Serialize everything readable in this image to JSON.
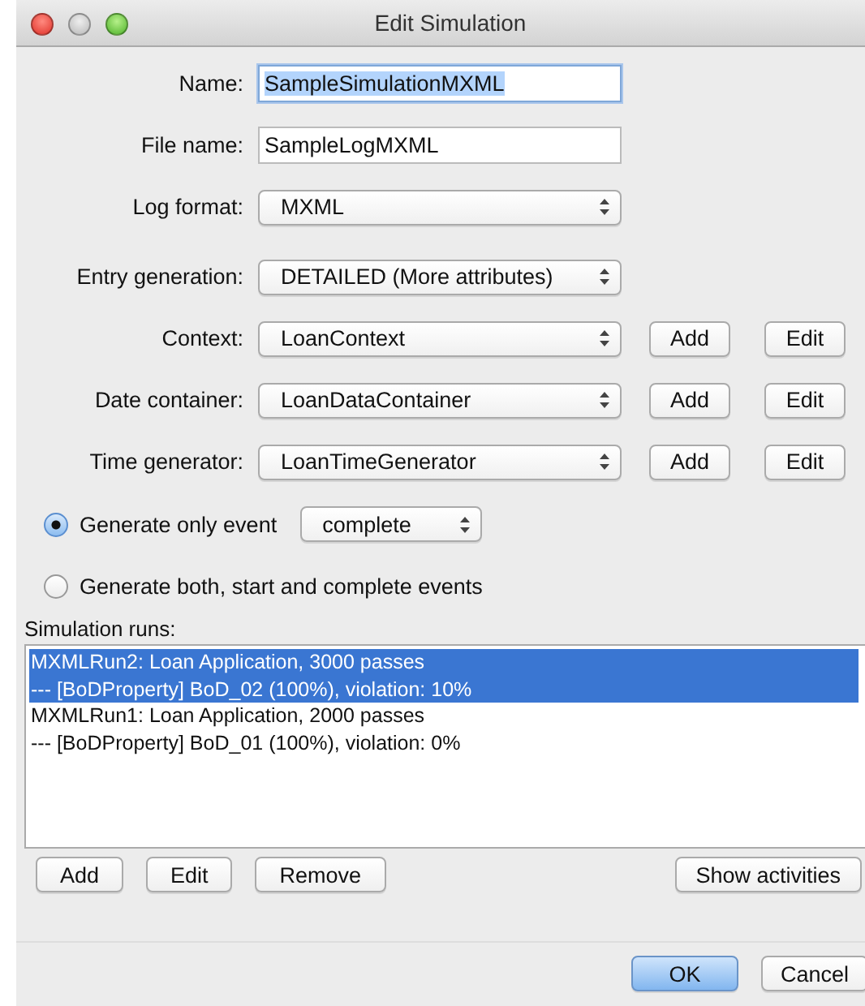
{
  "window": {
    "title": "Edit Simulation"
  },
  "form": [
    {
      "label": "Name:",
      "kind": "text",
      "value": "SampleSimulationMXML",
      "focused": true,
      "text_selected": true
    },
    {
      "label": "File name:",
      "kind": "text",
      "value": "SampleLogMXML",
      "focused": false,
      "text_selected": false
    },
    {
      "label": "Log format:",
      "kind": "select",
      "value": "MXML"
    },
    {
      "label": "Entry generation:",
      "kind": "select",
      "value": "DETAILED (More attributes)"
    },
    {
      "label": "Context:",
      "kind": "select",
      "value": "LoanContext",
      "buttons": [
        "Add",
        "Edit"
      ]
    },
    {
      "label": "Date container:",
      "kind": "select",
      "value": "LoanDataContainer",
      "buttons": [
        "Add",
        "Edit"
      ]
    },
    {
      "label": "Time generator:",
      "kind": "select",
      "value": "LoanTimeGenerator",
      "buttons": [
        "Add",
        "Edit"
      ]
    }
  ],
  "event_options": [
    {
      "label": "Generate only event",
      "selected": true,
      "select_value": "complete"
    },
    {
      "label": "Generate both, start and complete events",
      "selected": false
    }
  ],
  "simulation_runs": {
    "label": "Simulation runs:",
    "items": [
      {
        "line_1": "MXMLRun2: Loan Application, 3000 passes",
        "line_2": "--- [BoDProperty] BoD_02 (100%), violation: 10%",
        "selected": true
      },
      {
        "line_1": "MXMLRun1: Loan Application, 2000 passes",
        "line_2": "--- [BoDProperty] BoD_01 (100%), violation: 0%",
        "selected": false
      }
    ],
    "buttons": [
      "Add",
      "Edit",
      "Remove"
    ],
    "side_button": "Show activities"
  },
  "footer_buttons": [
    {
      "label": "OK",
      "default": true
    },
    {
      "label": "Cancel",
      "default": false
    }
  ]
}
